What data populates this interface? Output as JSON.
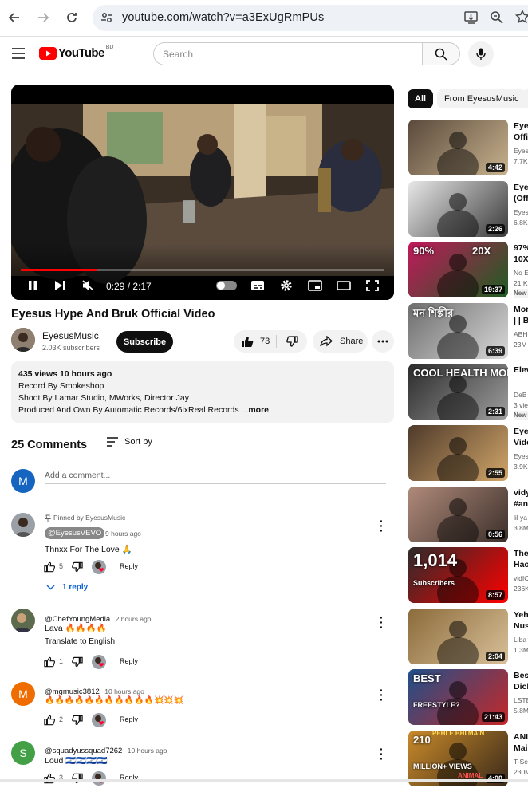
{
  "browser": {
    "url": "youtube.com/watch?v=a3ExUgRmPUs"
  },
  "header": {
    "logo_text": "YouTube",
    "country_code": "BD",
    "search_placeholder": "Search"
  },
  "player": {
    "time": "0:29 / 2:17",
    "progress": 0.21
  },
  "video": {
    "title": "Eyesus Hype And Bruk Official Video",
    "channel": "EyesusMusic",
    "subscribers": "2.03K subscribers",
    "subscribe_label": "Subscribe",
    "likes": "73",
    "share_label": "Share",
    "description": {
      "stats": "435 views  10 hours ago",
      "line1": "Record By Smokeshop",
      "line2": "Shoot By Lamar Studio, MWorks, Director Jay",
      "line3": "Produced And Own By Automatic Records/6ixReal Records ...",
      "more": "more"
    }
  },
  "comments": {
    "count_label": "25 Comments",
    "sort_label": "Sort by",
    "add_placeholder": "Add a comment...",
    "self_initial": "M",
    "items": [
      {
        "pinned": "Pinned by EyesusMusic",
        "author": "@EyesusVEVO",
        "time": "9 hours ago",
        "text": "Thnxx For The Love 🙏",
        "likes": "5",
        "reply": "Reply",
        "replies": "1 reply"
      },
      {
        "author": "@ChefYoungMedia",
        "time": "2 hours ago",
        "text": "Lava 🔥🔥🔥🔥",
        "translate": "Translate to English",
        "likes": "1",
        "reply": "Reply"
      },
      {
        "author": "@mgmusic3812",
        "time": "10 hours ago",
        "text": "🔥🔥🔥🔥🔥🔥🔥🔥🔥🔥🔥💥💥💥",
        "likes": "2",
        "reply": "Reply",
        "initial": "M"
      },
      {
        "author": "@squadyussquad7262",
        "time": "10 hours ago",
        "text": "Loud 🇸🇻🇸🇻🇸🇻🇸🇻",
        "likes": "3",
        "reply": "Reply",
        "initial": "S"
      }
    ]
  },
  "sidebar": {
    "chips": [
      "All",
      "From EyesusMusic"
    ],
    "videos": [
      {
        "title1": "Eyes",
        "title2": "Offic",
        "meta1": "Eyes",
        "meta2": "7.7K",
        "duration": "4:42"
      },
      {
        "title1": "Eyes",
        "title2": "(Off",
        "meta1": "Eyes",
        "meta2": "6.8K",
        "duration": "2:26"
      },
      {
        "title1": "97%",
        "title2": "10X",
        "meta1": "No E",
        "meta2": "21 K",
        "badge": "New",
        "duration": "19:37",
        "thumb_text1": "90%",
        "thumb_text2": "20X"
      },
      {
        "title1": "Mor",
        "title2": "| | B",
        "meta1": "ABH",
        "meta2": "23M",
        "duration": "6:39",
        "thumb_text1": "মন শিল্পীর"
      },
      {
        "title1": "Elev",
        "title2": "",
        "meta1": "DeB",
        "meta2": "3 vie",
        "badge": "New",
        "duration": "2:31",
        "thumb_text1": "COOL HEALTH MONEY"
      },
      {
        "title1": "Eyes",
        "title2": "Vide",
        "meta1": "Eyes",
        "meta2": "3.9K",
        "duration": "2:55"
      },
      {
        "title1": "vidy",
        "title2": "#an",
        "meta1": "lil ya",
        "meta2": "3.8M",
        "duration": "0:56"
      },
      {
        "title1": "The",
        "title2": "Hac",
        "meta1": "vidIC",
        "meta2": "236K",
        "duration": "8:57",
        "thumb_text1": "1,014",
        "thumb_text2": "Subscribers"
      },
      {
        "title1": "Yeh",
        "title2": "Nus",
        "meta1": "Liba",
        "meta2": "1.3M",
        "duration": "2:04"
      },
      {
        "title1": "Bes",
        "title2": "Dick",
        "meta1": "LSTE",
        "meta2": "5.8M",
        "duration": "21:43",
        "thumb_text1": "BEST",
        "thumb_text2": "FREESTYLE?"
      },
      {
        "title1": "ANI",
        "title2": "Mai",
        "meta1": "T-Se",
        "meta2": "230M",
        "duration": "4:00",
        "thumb_text1": "210",
        "thumb_text2": "MILLION+ VIEWS",
        "thumb_text3": "PEHLE BHI MAIN",
        "thumb_text4": "ANIMAL"
      }
    ]
  }
}
